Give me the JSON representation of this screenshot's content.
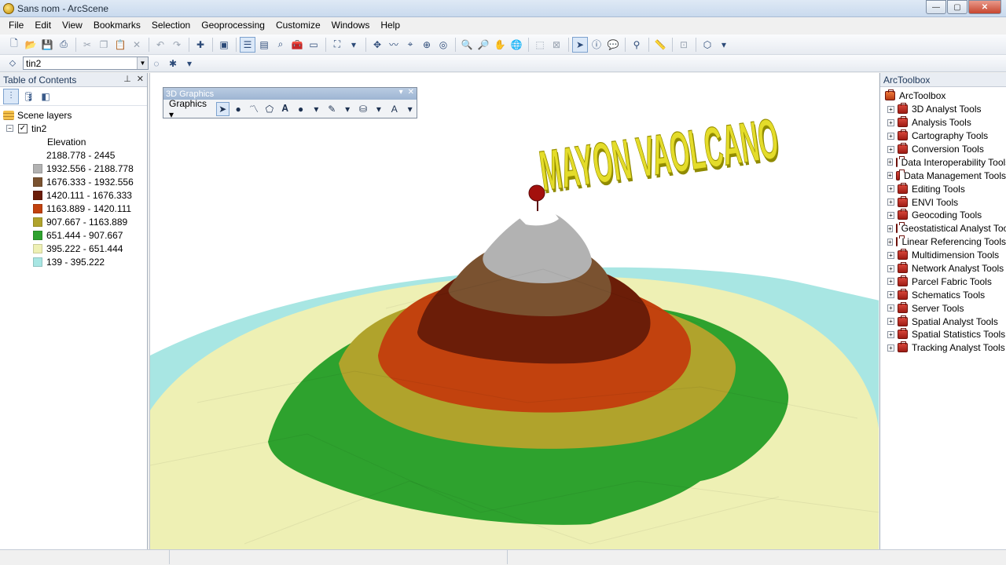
{
  "window": {
    "title": "Sans nom - ArcScene",
    "minimize": "—",
    "maximize": "▢",
    "close": "✕"
  },
  "menu": [
    "File",
    "Edit",
    "View",
    "Bookmarks",
    "Selection",
    "Geoprocessing",
    "Customize",
    "Windows",
    "Help"
  ],
  "toolbar2": {
    "layer_value": "tin2"
  },
  "toc": {
    "title": "Table of Contents",
    "pin_icon": "pin-icon",
    "close_icon": "close-icon",
    "root_label": "Scene layers",
    "layer_name": "tin2",
    "layer_checked": "✓",
    "legend_title": "Elevation",
    "legend": [
      {
        "label": "2188.778 - 2445",
        "color": "#ffffff"
      },
      {
        "label": "1932.556 - 2188.778",
        "color": "#b2b2b2"
      },
      {
        "label": "1676.333 - 1932.556",
        "color": "#7a5230"
      },
      {
        "label": "1420.111 - 1676.333",
        "color": "#6b1d08"
      },
      {
        "label": "1163.889 - 1420.111",
        "color": "#c2420e"
      },
      {
        "label": "907.667 - 1163.889",
        "color": "#b0a32c"
      },
      {
        "label": "651.444 - 907.667",
        "color": "#2ea22e"
      },
      {
        "label": "395.222 - 651.444",
        "color": "#eef0b4"
      },
      {
        "label": "139 - 395.222",
        "color": "#a8e6e3"
      }
    ]
  },
  "graphics_toolbar": {
    "title": "3D Graphics",
    "menu_label": "Graphics ▾",
    "close": "✕",
    "dropdown": "▾"
  },
  "scene": {
    "label_3d_text": "MAYON  VAOLCANO"
  },
  "toolbox": {
    "title": "ArcToolbox",
    "root": "ArcToolbox",
    "items": [
      "3D Analyst Tools",
      "Analysis Tools",
      "Cartography Tools",
      "Conversion Tools",
      "Data Interoperability Tools",
      "Data Management Tools",
      "Editing Tools",
      "ENVI Tools",
      "Geocoding Tools",
      "Geostatistical Analyst Tools",
      "Linear Referencing Tools",
      "Multidimension Tools",
      "Network Analyst Tools",
      "Parcel Fabric Tools",
      "Schematics Tools",
      "Server Tools",
      "Spatial Analyst Tools",
      "Spatial Statistics Tools",
      "Tracking Analyst Tools"
    ]
  },
  "colors": {
    "accent": "#7da2ce",
    "titlebar": "#c9daee"
  }
}
